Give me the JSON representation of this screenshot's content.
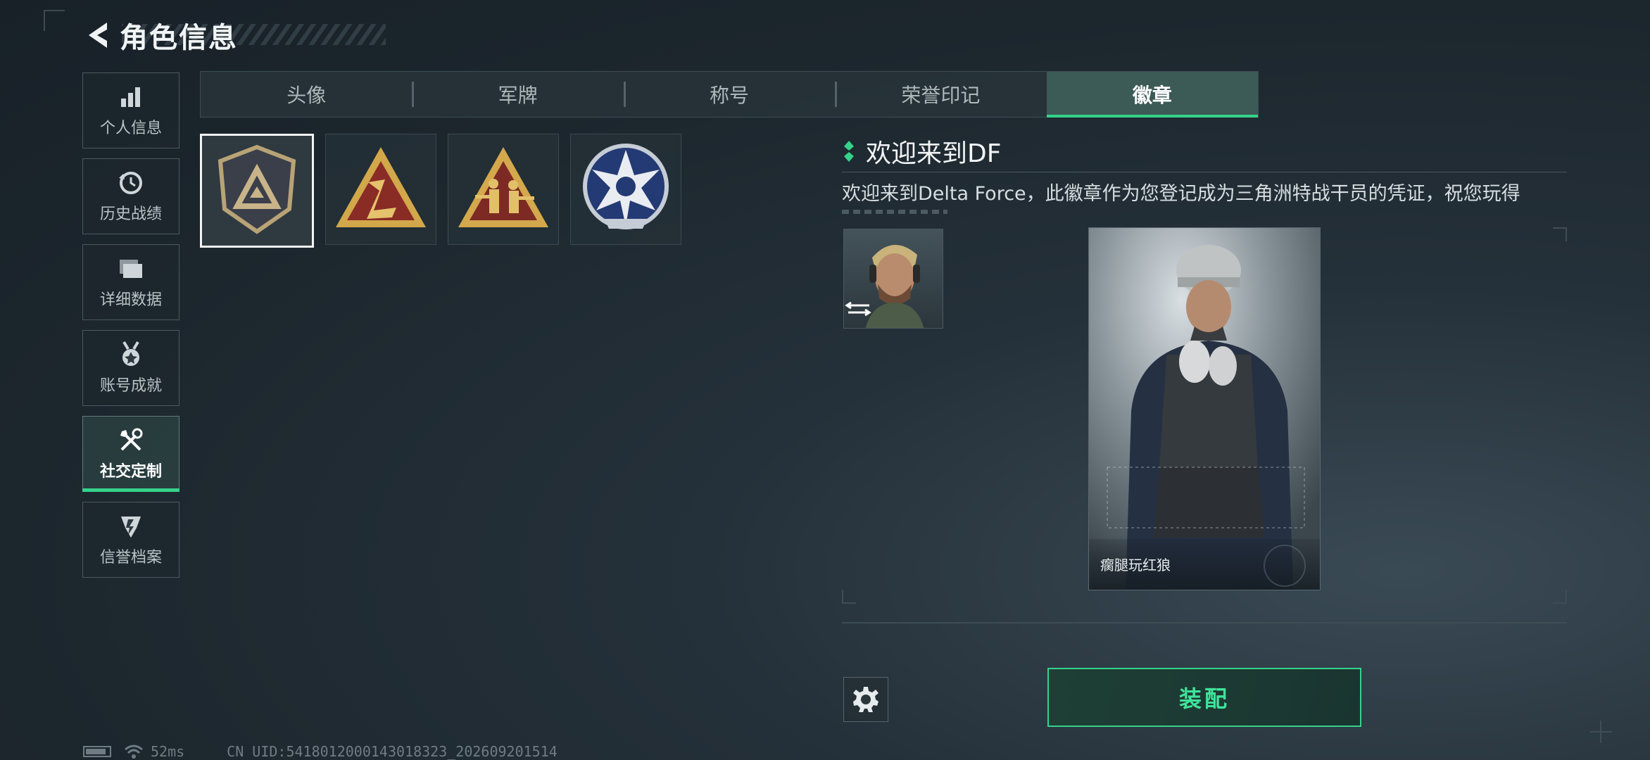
{
  "header": {
    "title": "角色信息"
  },
  "sidebar": {
    "items": [
      {
        "label": "个人信息",
        "icon": "bar-chart-icon"
      },
      {
        "label": "历史战绩",
        "icon": "history-clock-icon"
      },
      {
        "label": "详细数据",
        "icon": "folders-icon"
      },
      {
        "label": "账号成就",
        "icon": "medal-icon"
      },
      {
        "label": "社交定制",
        "icon": "tools-icon",
        "active": true
      },
      {
        "label": "信誉档案",
        "icon": "credit-shield-icon"
      }
    ]
  },
  "tabs": [
    {
      "label": "头像"
    },
    {
      "label": "军牌"
    },
    {
      "label": "称号"
    },
    {
      "label": "荣誉印记"
    },
    {
      "label": "徽章",
      "active": true
    }
  ],
  "badges": [
    {
      "name": "delta-shield-badge",
      "selected": true
    },
    {
      "name": "red-triangle-badge"
    },
    {
      "name": "soldiers-triangle-badge"
    },
    {
      "name": "star-emblem-badge"
    }
  ],
  "detail": {
    "title": "欢迎来到DF",
    "description": "欢迎来到Delta Force，此徽章作为您登记成为三角洲特战干员的凭证，祝您玩得"
  },
  "card": {
    "player_name": "瘸腿玩红狼"
  },
  "actions": {
    "equip_label": "装配"
  },
  "status": {
    "ping": "52ms",
    "uid": "CN UID:54180120001430183​23_202609201514"
  },
  "colors": {
    "accent": "#35d28a",
    "background": "#1c262d"
  }
}
